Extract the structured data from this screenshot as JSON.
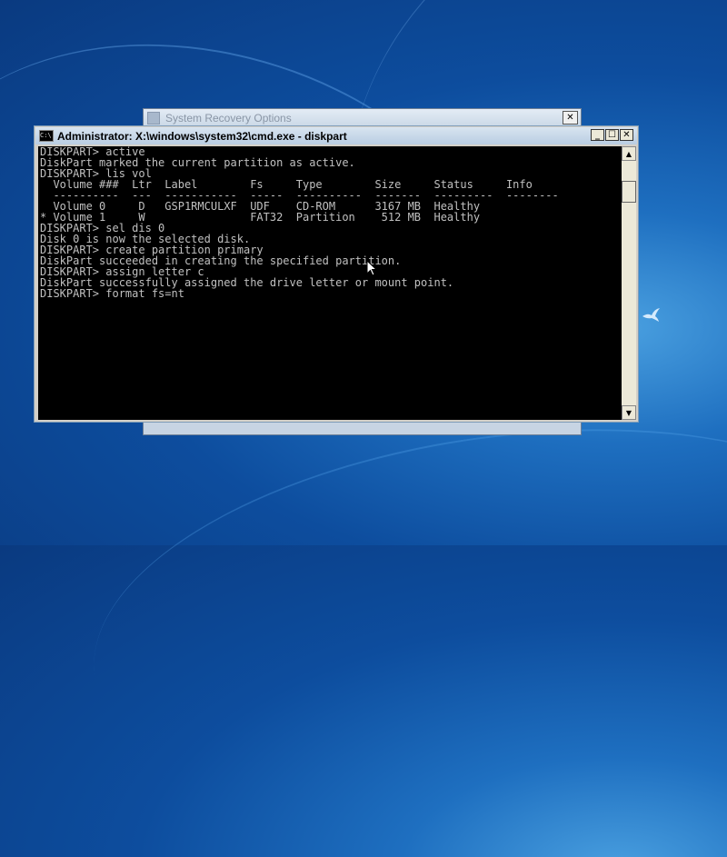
{
  "background_dialog": {
    "title": "System Recovery Options",
    "close_label": "✕"
  },
  "cmd_window": {
    "title": "Administrator: X:\\windows\\system32\\cmd.exe - diskpart",
    "icon_text": "C:\\",
    "buttons": {
      "minimize": "_",
      "maximize": "☐",
      "close": "✕"
    },
    "lines": [
      "DISKPART> active",
      "",
      "DiskPart marked the current partition as active.",
      "",
      "DISKPART> lis vol",
      "",
      "  Volume ###  Ltr  Label        Fs     Type        Size     Status     Info",
      "  ----------  ---  -----------  -----  ----------  -------  ---------  --------",
      "  Volume 0     D   GSP1RMCULXF  UDF    CD-ROM      3167 MB  Healthy",
      "* Volume 1     W                FAT32  Partition    512 MB  Healthy",
      "",
      "DISKPART> sel dis 0",
      "",
      "Disk 0 is now the selected disk.",
      "",
      "DISKPART> create partition primary",
      "",
      "DiskPart succeeded in creating the specified partition.",
      "",
      "DISKPART> assign letter c",
      "",
      "DiskPart successfully assigned the drive letter or mount point.",
      "",
      "DISKPART> format fs=nt"
    ]
  },
  "scrollbar": {
    "up_arrow": "▲",
    "down_arrow": "▼"
  },
  "colors": {
    "console_bg": "#000000",
    "console_text": "#c0c0c0",
    "desktop": "#1e6fc0"
  }
}
